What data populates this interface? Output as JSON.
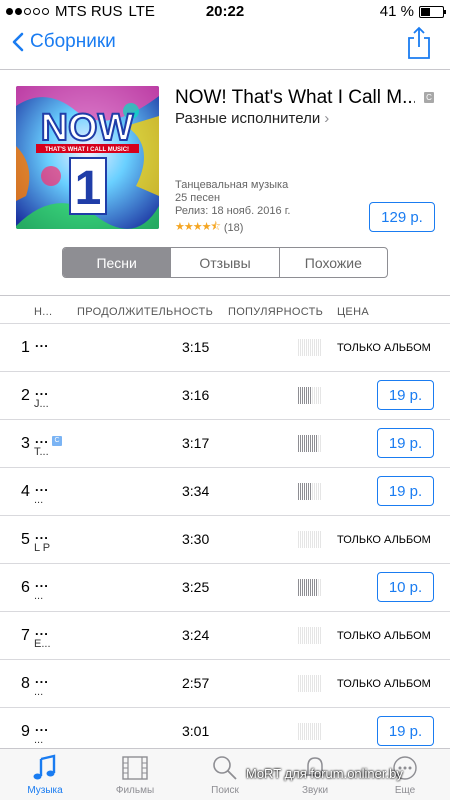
{
  "status": {
    "carrier": "MTS RUS",
    "network": "LTE",
    "time": "20:22",
    "battery": "41 %",
    "battery_level": 0.41
  },
  "nav": {
    "back_label": "Сборники"
  },
  "album": {
    "title": "NOW! That's What I Call M...",
    "explicit_badge": "C",
    "artist": "Разные исполнители",
    "genre": "Танцевальная музыка",
    "track_count": "25 песен",
    "release": "Релиз: 18 нояб. 2016 г.",
    "rating_stars": 4.5,
    "rating_count": "(18)",
    "price": "129 р.",
    "cover_text": {
      "logo": "NOW",
      "tagline": "THAT'S WHAT I CALL MUSIC!"
    }
  },
  "segments": [
    "Песни",
    "Отзывы",
    "Похожие"
  ],
  "table": {
    "headers": {
      "name": "Н...",
      "duration": "ПРОДОЛЖИТЕЛЬНОСТЬ",
      "popularity": "ПОПУЛЯРНОСТЬ",
      "price": "ЦЕНА"
    },
    "rows": [
      {
        "num": "1",
        "name": "...",
        "sub": "",
        "explicit": false,
        "duration": "3:15",
        "popularity": 0.0,
        "price": "ТОЛЬКО АЛЬБОМ",
        "buyable": false
      },
      {
        "num": "2",
        "name": "...",
        "sub": "J...",
        "explicit": false,
        "duration": "3:16",
        "popularity": 0.55,
        "price": "19 р.",
        "buyable": true
      },
      {
        "num": "3",
        "name": "...",
        "sub": "T...",
        "explicit": true,
        "duration": "3:17",
        "popularity": 0.85,
        "price": "19 р.",
        "buyable": true
      },
      {
        "num": "4",
        "name": "...",
        "sub": "...",
        "explicit": false,
        "duration": "3:34",
        "popularity": 0.55,
        "price": "19 р.",
        "buyable": true
      },
      {
        "num": "5",
        "name": "...",
        "sub": "L P",
        "explicit": false,
        "duration": "3:30",
        "popularity": 0.0,
        "price": "ТОЛЬКО АЛЬБОМ",
        "buyable": false
      },
      {
        "num": "6",
        "name": "...",
        "sub": "...",
        "explicit": false,
        "duration": "3:25",
        "popularity": 0.85,
        "price": "10 р.",
        "buyable": true
      },
      {
        "num": "7",
        "name": "...",
        "sub": "E...",
        "explicit": false,
        "duration": "3:24",
        "popularity": 0.0,
        "price": "ТОЛЬКО АЛЬБОМ",
        "buyable": false
      },
      {
        "num": "8",
        "name": "...",
        "sub": "...",
        "explicit": false,
        "duration": "2:57",
        "popularity": 0.0,
        "price": "ТОЛЬКО АЛЬБОМ",
        "buyable": false
      },
      {
        "num": "9",
        "name": "...",
        "sub": "...",
        "explicit": false,
        "duration": "3:01",
        "popularity": 0.0,
        "price": "19 р.",
        "buyable": true
      }
    ]
  },
  "tabs": [
    {
      "label": "Музыка",
      "icon": "music-note-icon",
      "active": true
    },
    {
      "label": "Фильмы",
      "icon": "film-icon",
      "active": false
    },
    {
      "label": "Поиск",
      "icon": "search-icon",
      "active": false
    },
    {
      "label": "Звуки",
      "icon": "bell-icon",
      "active": false
    },
    {
      "label": "Еще",
      "icon": "more-icon",
      "active": false
    }
  ],
  "watermark": "MoRT для forum.onliner.by",
  "colors": {
    "accent": "#1a7cf1",
    "segment_active": "#8e8e93"
  }
}
